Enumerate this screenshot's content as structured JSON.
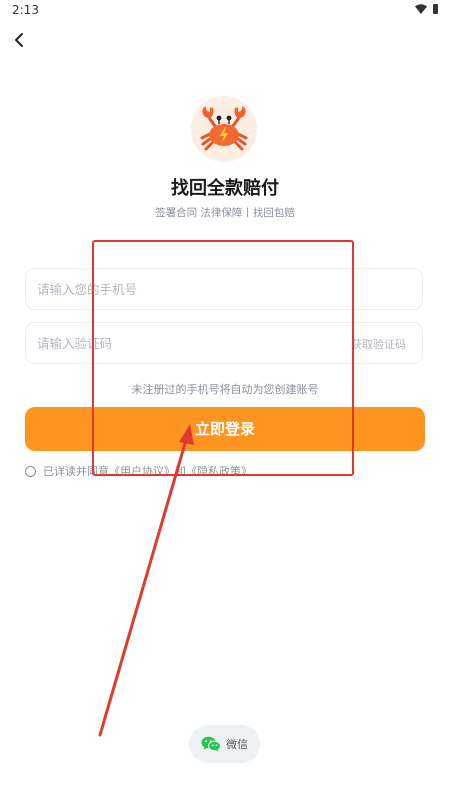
{
  "status_bar": {
    "time": "2:13"
  },
  "header": {
    "back_icon": "chevron-left-icon"
  },
  "brand": {
    "logo_icon": "crab-lightning-logo",
    "title": "找回全款赔付",
    "subtitle": "签署合同  法律保障丨找回包赔"
  },
  "form": {
    "phone_placeholder": "请输入您的手机号",
    "code_placeholder": "请输入验证码",
    "get_code_label": "获取验证码",
    "auto_register_hint": "未注册过的手机号将自动为您创建账号",
    "login_button": "立即登录"
  },
  "agreement": {
    "checked": false,
    "prefix": "已详读并同意",
    "user_agreement": "《用户协议》",
    "and": "和",
    "privacy_policy": "《隐私政策》"
  },
  "social_login": {
    "wechat_label": "微信",
    "icon": "wechat-icon"
  },
  "colors": {
    "primary": "#ff9421",
    "annotation": "#e03a2f",
    "muted_text": "#8a8f99",
    "placeholder": "#b3b7bf",
    "wechat_green": "#2ac350"
  }
}
